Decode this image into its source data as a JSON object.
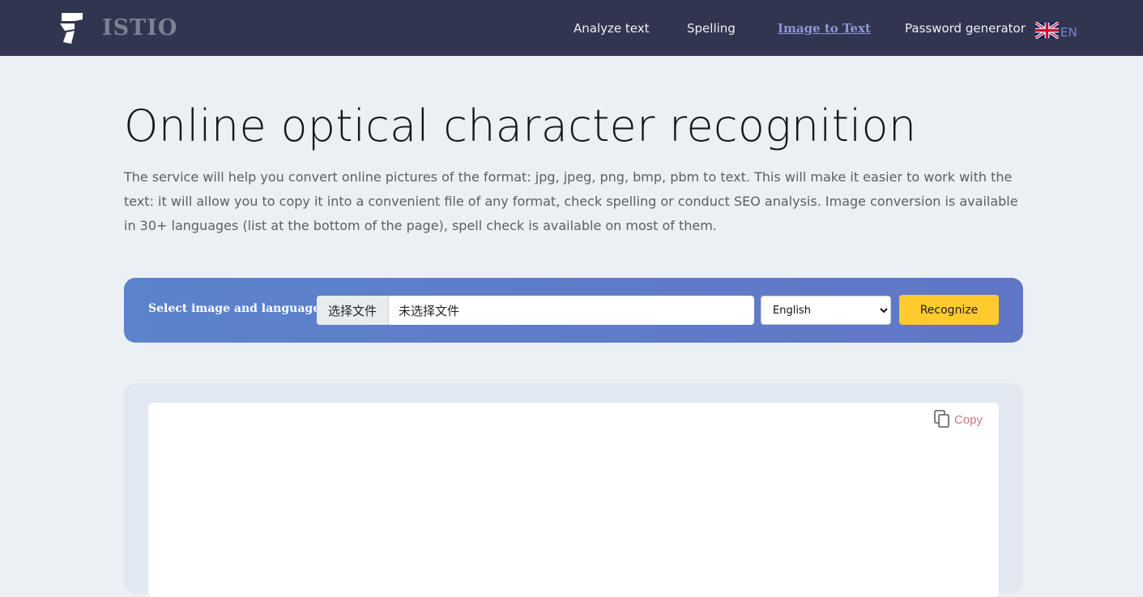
{
  "header": {
    "brand": "ISTIO",
    "nav": [
      {
        "label": "Analyze text"
      },
      {
        "label": "Spelling"
      },
      {
        "label": "Image to Text"
      },
      {
        "label": "Password generator"
      }
    ],
    "language": {
      "code": "EN",
      "flag_icon": "uk-flag-icon"
    }
  },
  "main": {
    "title": "Online optical character recognition",
    "intro": "The service will help you convert online pictures of the format: jpg, jpeg, png, bmp, pbm to text. This will make it easier to work with the text: it will allow you to copy it into a convenient file of any format, check spelling or conduct SEO analysis. Image conversion is available in 30+ languages (list at the bottom of the page), spell check is available on most of them."
  },
  "tool": {
    "label": "Select image and language:",
    "file_button": "选择文件",
    "file_status": "未选择文件",
    "language_selected": "English",
    "recognize_label": "Recognize"
  },
  "result": {
    "copy_label": "Copy",
    "copy_icon": "copy-icon"
  },
  "colors": {
    "header_bg": "#30364f",
    "page_bg": "#ebf0f4",
    "accent_yellow": "#ffcb2e",
    "active_link": "#8f97d8"
  }
}
